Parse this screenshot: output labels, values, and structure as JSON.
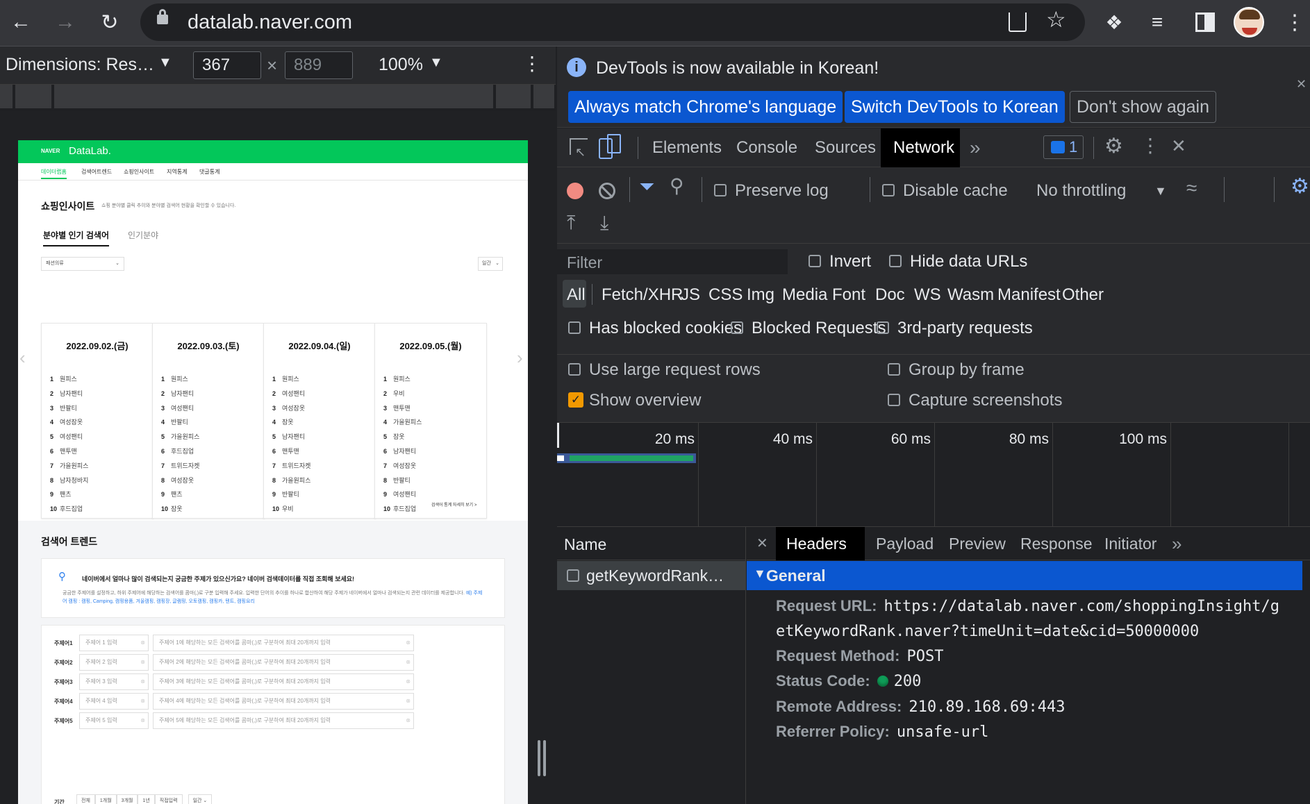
{
  "browser": {
    "url": "datalab.naver.com",
    "icons": [
      "back-arrow-icon",
      "forward-arrow-icon",
      "reload-icon",
      "lock-icon",
      "share-icon",
      "star-icon",
      "extensions-puzzle-icon",
      "media-playlist-icon",
      "side-panel-icon",
      "profile-avatar",
      "more-vert-icon"
    ]
  },
  "device_toolbar": {
    "dimensions_label": "Dimensions: Res…",
    "width": "367",
    "height": "889",
    "times": "×",
    "zoom": "100%"
  },
  "naver_page": {
    "logo_naver": "NAVER",
    "logo_datalab": "DataLab.",
    "nav": [
      "데이터랩홈",
      "검색어트렌드",
      "쇼핑인사이트",
      "지역통계",
      "댓글통계"
    ],
    "shopping_title": "쇼핑인사이트",
    "shopping_desc": "쇼핑 분야별 클릭 추이와 분야별 검색어 현황을 확인할 수 있습니다.",
    "subtabs": [
      "분야별 인기 검색어",
      "인기분야"
    ],
    "category_select": "패션의류",
    "period_select": "일간",
    "date_cards": [
      {
        "date": "2022.09.02.(금)",
        "items": [
          "원피스",
          "남자팬티",
          "반팔티",
          "여성잠옷",
          "여성팬티",
          "맨투맨",
          "가을원피스",
          "남자청바지",
          "팬츠",
          "후드집업"
        ]
      },
      {
        "date": "2022.09.03.(토)",
        "items": [
          "원피스",
          "남자팬티",
          "여성팬티",
          "반팔티",
          "가을원피스",
          "후드집업",
          "트위드자켓",
          "여성잠옷",
          "팬츠",
          "잠옷"
        ]
      },
      {
        "date": "2022.09.04.(일)",
        "items": [
          "원피스",
          "여성팬티",
          "여성잠옷",
          "잠옷",
          "남자팬티",
          "맨투맨",
          "트위드자켓",
          "가을원피스",
          "반팔티",
          "우비"
        ]
      },
      {
        "date": "2022.09.05.(월)",
        "items": [
          "원피스",
          "우비",
          "맨투맨",
          "가을원피스",
          "잠옷",
          "남자팬티",
          "여성잠옷",
          "반팔티",
          "여성팬티",
          "후드집업"
        ]
      }
    ],
    "more_link": "검색어 통계 자세히 보기 >",
    "trend_title": "검색어 트렌드",
    "trend_headline": "네이버에서 얼마나 많이 검색되는지 궁금한 주제가 있으신가요? 네이버 검색데이터를 직접 조회해 보세요!",
    "trend_desc": "궁금한 주제어를 설정하고, 하위 주제어에 해당하는 검색어를 콤마(,)로 구분 입력해 주세요. 입력한 단어의 추이를 하나로 합산하여 해당 주제가 네이버에서 얼마나 검색되는지 관련 데이터를 제공합니다.",
    "trend_example": "예) 주제어 캠핑 : 캠핑, Camping, 캠핑용품, 겨울캠핑, 캠핑장, 글램핑, 오토캠핑, 캠핑카, 텐트, 캠핑요리",
    "topics": [
      {
        "label": "주제어1",
        "name_ph": "주제어 1 입력",
        "kw_ph": "주제어 1에 해당하는 모든 검색어를 콤마(,)로 구분하여 최대 20개까지 입력"
      },
      {
        "label": "주제어2",
        "name_ph": "주제어 2 입력",
        "kw_ph": "주제어 2에 해당하는 모든 검색어를 콤마(,)로 구분하여 최대 20개까지 입력"
      },
      {
        "label": "주제어3",
        "name_ph": "주제어 3 입력",
        "kw_ph": "주제어 3에 해당하는 모든 검색어를 콤마(,)로 구분하여 최대 20개까지 입력"
      },
      {
        "label": "주제어4",
        "name_ph": "주제어 4 입력",
        "kw_ph": "주제어 4에 해당하는 모든 검색어를 콤마(,)로 구분하여 최대 20개까지 입력"
      },
      {
        "label": "주제어5",
        "name_ph": "주제어 5 입력",
        "kw_ph": "주제어 5에 해당하는 모든 검색어를 콤마(,)로 구분하여 최대 20개까지 입력"
      }
    ],
    "period_label": "기간",
    "period_options": [
      "전체",
      "1개월",
      "3개월",
      "1년",
      "직접입력"
    ],
    "period_unit": "일간"
  },
  "devtools": {
    "banner_text": "DevTools is now available in Korean!",
    "btn_match": "Always match Chrome's language",
    "btn_switch": "Switch DevTools to Korean",
    "btn_dont_show": "Don't show again",
    "tabs": [
      "Elements",
      "Console",
      "Sources",
      "Network"
    ],
    "active_tab": "Network",
    "more_tabs": "»",
    "issues_count": "1",
    "preserve_log": "Preserve log",
    "disable_cache": "Disable cache",
    "throttling": "No throttling",
    "filter_placeholder": "Filter",
    "invert": "Invert",
    "hide_data_urls": "Hide data URLs",
    "types": [
      "All",
      "Fetch/XHR",
      "JS",
      "CSS",
      "Img",
      "Media",
      "Font",
      "Doc",
      "WS",
      "Wasm",
      "Manifest",
      "Other"
    ],
    "has_blocked_cookies": "Has blocked cookies",
    "blocked_requests": "Blocked Requests",
    "third_party": "3rd-party requests",
    "large_rows": "Use large request rows",
    "group_by_frame": "Group by frame",
    "show_overview": "Show overview",
    "capture_screenshots": "Capture screenshots",
    "timeline_labels": [
      "20 ms",
      "40 ms",
      "60 ms",
      "80 ms",
      "100 ms"
    ],
    "name_header": "Name",
    "request_name": "getKeywordRank…",
    "detail_tabs": [
      "Headers",
      "Payload",
      "Preview",
      "Response",
      "Initiator"
    ],
    "general_label": "General",
    "headers": {
      "request_url_k": "Request URL:",
      "request_url_v1": "https://datalab.naver.com/shoppingInsight/g",
      "request_url_v2": "etKeywordRank.naver?timeUnit=date&cid=50000000",
      "method_k": "Request Method:",
      "method_v": "POST",
      "status_k": "Status Code:",
      "status_v": "200",
      "remote_k": "Remote Address:",
      "remote_v": "210.89.168.69:443",
      "referrer_k": "Referrer Policy:",
      "referrer_v": "unsafe-url"
    },
    "colors": {
      "accent": "#1a73e8",
      "active_btn": "#0b57d0",
      "record": "#f28b82",
      "status_ok": "#0f9d58",
      "bar": "#1fa363"
    }
  }
}
